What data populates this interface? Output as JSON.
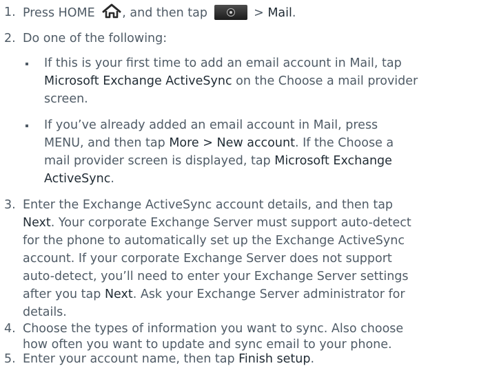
{
  "step1": {
    "num": "1.",
    "t1": "Press HOME ",
    "t2": ", and then tap ",
    "t3": " > ",
    "t4": "Mail",
    "t5": "."
  },
  "step2": {
    "num": "2.",
    "t1": "Do one of the following:"
  },
  "bullet1": {
    "l1a": "If this is your first time to add an email account in Mail, tap",
    "l2a": "Microsoft Exchange ActiveSync",
    "l2b": " on the Choose a mail provider",
    "l3a": "screen."
  },
  "bullet2": {
    "l1a": "If you’ve already added an email account in Mail, press",
    "l2a": "MENU, and then tap ",
    "l2b": "More > New account",
    "l2c": ". If the Choose a",
    "l3a": "mail provider screen is displayed, tap ",
    "l3b": "Microsoft Exchange",
    "l4a": "ActiveSync",
    "l4b": "."
  },
  "step3": {
    "num": "3.",
    "l1a": "Enter the Exchange ActiveSync account details, and then tap",
    "l2a": "Next",
    "l2b": ". Your corporate Exchange Server must support auto-detect",
    "l3a": "for the phone to automatically set up the Exchange ActiveSync",
    "l4a": "account. If your corporate Exchange Server does not support",
    "l5a": "auto-detect, you’ll need to enter your Exchange Server settings",
    "l6a": "after you tap ",
    "l6b": "Next",
    "l6c": ". Ask your Exchange Server administrator for",
    "l7a": "details."
  },
  "step4": {
    "num": "4.",
    "l1a": "Choose the types of information you want to sync. Also choose",
    "l2a": "how often you want to update and sync email to your phone."
  },
  "step5": {
    "num": "5.",
    "l1a": "Enter your account name, then tap ",
    "l1b": "Finish setup",
    "l1c": "."
  },
  "icons": {
    "home": "home-icon",
    "apps": "all-apps-icon"
  },
  "colors": {
    "body_text": "#4f5b66",
    "emphasis_text": "#1f2a33"
  }
}
